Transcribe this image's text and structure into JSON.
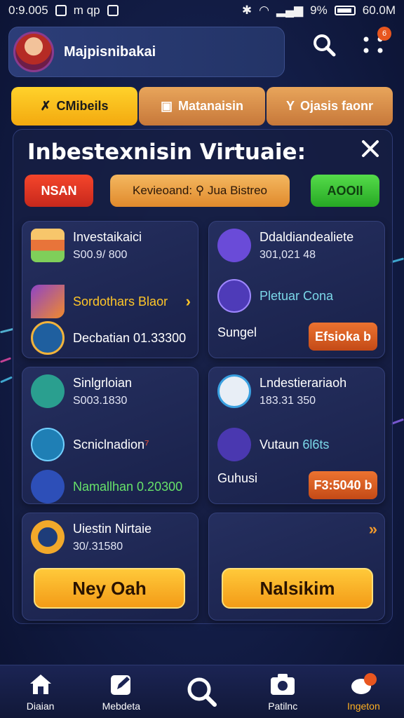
{
  "status_bar": {
    "time": "0:9.005",
    "icons_left": "m qp",
    "battery_percent": "9%",
    "data": "60.0M"
  },
  "header": {
    "username": "Majpisnibakai",
    "notification_count": "6"
  },
  "tabs": [
    {
      "label": "CMibeils",
      "icon": "x-icon"
    },
    {
      "label": "Matanaisin",
      "icon": "square-icon"
    },
    {
      "label": "Ojasis faonr",
      "icon": "y-icon"
    }
  ],
  "panel": {
    "title": "Inbestexnisin Virtuaie:",
    "actions": {
      "red": "NSAN",
      "orange": "Kevieoand: ⚲ Jua Bistreo",
      "green": "AOOII"
    }
  },
  "cards": {
    "c1": {
      "r1": {
        "title": "Investaikaici",
        "sub": "S00.9/ 800"
      },
      "r2": {
        "title": "Sordothars Blaor"
      },
      "r3": {
        "title": "Decbatian 01.33300"
      }
    },
    "c2": {
      "r1": {
        "title": "Ddaldiandealiete",
        "sub": "301,021 48"
      },
      "r2": {
        "title": "Pletuar Cona"
      },
      "r3": {
        "title": "Sungel"
      },
      "button": "Efsioka b"
    },
    "c3": {
      "r1": {
        "title": "Sinlgrloian",
        "sub": "S003.1830"
      },
      "r2": {
        "title": "Scniclnadion",
        "mark": "⁷"
      },
      "r3": {
        "title": "Namallhan 0.20300"
      }
    },
    "c4": {
      "r1": {
        "title": "Lndestierariaoh",
        "sub": "183.31 350"
      },
      "r2": {
        "title": "Vutaun ",
        "accent": "6l6ts"
      },
      "r3": {
        "title": "Guhusi"
      },
      "button": "F3:5040 b"
    },
    "c5": {
      "r1": {
        "title": "Uiestin Nirtaie",
        "sub": "30/.31580"
      },
      "button": "Ney Oah"
    },
    "c6": {
      "button": "Nalsikim"
    }
  },
  "bottom_nav": [
    {
      "label": "Diaian",
      "icon": "home-icon"
    },
    {
      "label": "Mebdeta",
      "icon": "edit-icon"
    },
    {
      "label": "",
      "icon": "search-icon"
    },
    {
      "label": "Patilnc",
      "icon": "camera-icon"
    },
    {
      "label": "Ingeton",
      "icon": "chat-icon"
    }
  ],
  "colors": {
    "accent": "#f3a90f",
    "background": "#141f4a",
    "orange_button": "#e37a2d",
    "red_button": "#e43a24",
    "green_button": "#3cc235"
  }
}
